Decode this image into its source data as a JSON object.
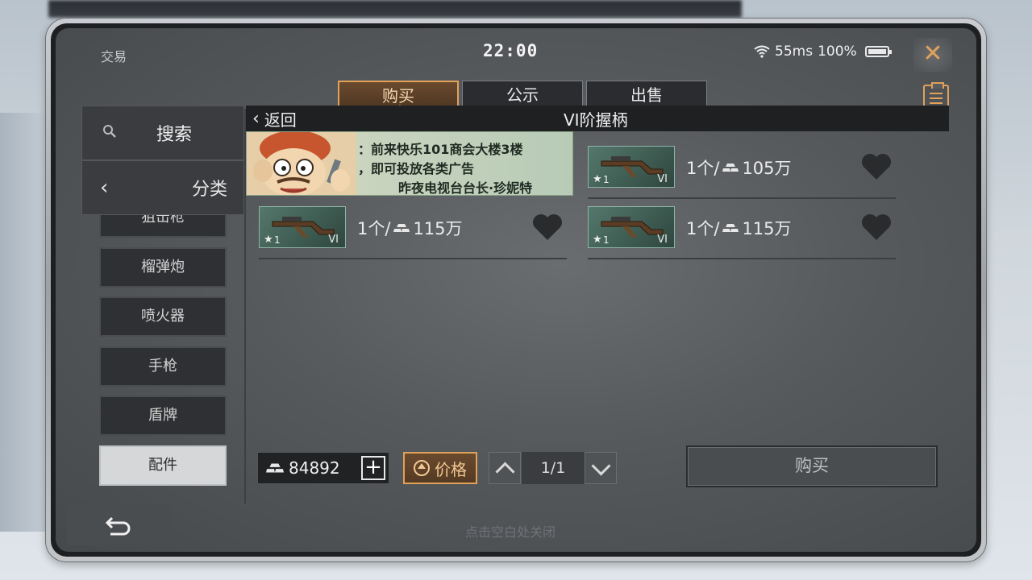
{
  "status": {
    "app_title": "交易",
    "clock": "22:00",
    "ping": "55ms",
    "battery": "100%"
  },
  "tabs": [
    {
      "label": "购买",
      "active": true
    },
    {
      "label": "公示",
      "active": false
    },
    {
      "label": "出售",
      "active": false
    }
  ],
  "sidebar": {
    "search_label": "搜索",
    "category_label": "分类",
    "categories": [
      {
        "label": "狙击枪",
        "selected": false
      },
      {
        "label": "榴弹炮",
        "selected": false
      },
      {
        "label": "喷火器",
        "selected": false
      },
      {
        "label": "手枪",
        "selected": false
      },
      {
        "label": "盾牌",
        "selected": false
      },
      {
        "label": "配件",
        "selected": true
      }
    ]
  },
  "list": {
    "back_label": "返回",
    "title": "VI阶握柄"
  },
  "ad": {
    "line1": "：前来快乐101商会大楼3楼",
    "line2": "，即可投放各类广告",
    "line3": "昨夜电视台台长·珍妮特"
  },
  "items": [
    {
      "tier": "VI",
      "stars": "1",
      "qty": "1个/",
      "price": "105万",
      "icon": "grip-icon"
    },
    {
      "tier": "VI",
      "stars": "1",
      "qty": "1个/",
      "price": "115万",
      "icon": "grip-icon"
    },
    {
      "tier": "VI",
      "stars": "1",
      "qty": "1个/",
      "price": "115万",
      "icon": "grip-icon"
    }
  ],
  "footer": {
    "balance": "84892",
    "sort_label": "价格",
    "page": "1/1",
    "buy_label": "购买",
    "close_hint": "点击空白处关闭"
  },
  "colors": {
    "accent": "#e0a15a",
    "panel_dark": "#1f2022",
    "screen_bg": "#56595c"
  }
}
